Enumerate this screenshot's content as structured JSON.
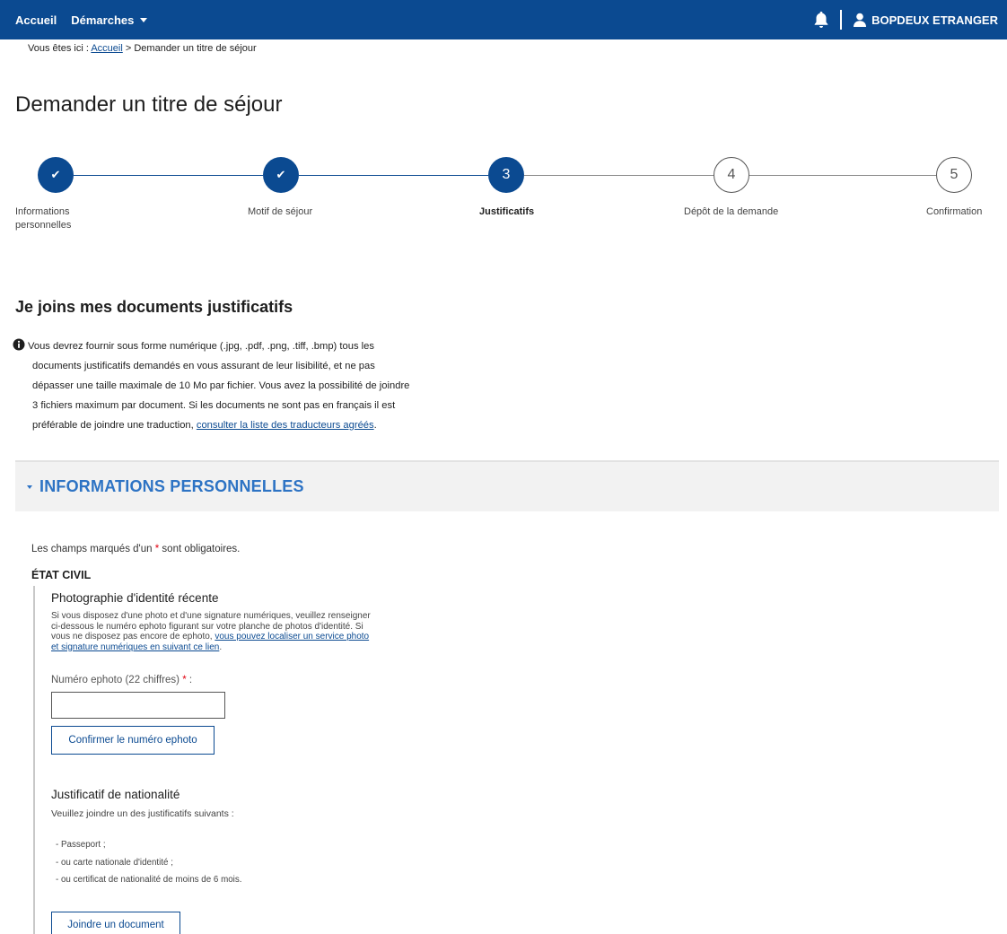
{
  "topbar": {
    "home_label": "Accueil",
    "demarches_label": "Démarches",
    "user_name": "BOPDEUX ETRANGER",
    "icons": {
      "bell": "bell-icon",
      "user": "user-icon",
      "caret": "caret-down-icon"
    },
    "colors": {
      "background": "#0b4a91",
      "text": "#ffffff"
    }
  },
  "breadcrumb": {
    "prefix": "Vous êtes ici :",
    "home_link": "Accueil",
    "separator": ">",
    "current": "Demander un titre de séjour"
  },
  "page": {
    "title": "Demander un titre de séjour"
  },
  "stepper": {
    "current_step": 3,
    "steps": [
      {
        "marker": "✔",
        "label_line1": "Informations",
        "label_line2": "personnelles",
        "state": "done"
      },
      {
        "marker": "✔",
        "label_line1": "Motif de séjour",
        "label_line2": "",
        "state": "done"
      },
      {
        "marker": "3",
        "label_line1": "Justificatifs",
        "label_line2": "",
        "state": "current"
      },
      {
        "marker": "4",
        "label_line1": "Dépôt de la demande",
        "label_line2": "",
        "state": "todo"
      },
      {
        "marker": "5",
        "label_line1": "Confirmation",
        "label_line2": "",
        "state": "todo"
      }
    ],
    "colors": {
      "active": "#0b4a91",
      "inactive_line": "#888888"
    }
  },
  "main": {
    "heading": "Je joins mes documents justificatifs",
    "info": {
      "icon": "info-icon",
      "line1": "Vous devrez fournir sous forme numérique (.jpg, .pdf, .png, .tiff, .bmp) tous les",
      "line2": "documents justificatifs demandés en vous assurant de leur lisibilité, et ne pas",
      "line3": "dépasser une taille maximale de 10 Mo par fichier. Vous avez la possibilité de joindre",
      "line4": "3 fichiers maximum par document. Si les documents ne sont pas en français il est",
      "line5_text": "préférable de joindre une traduction,",
      "line5_link": "consulter la liste des traducteurs agréés",
      "line5_end": "."
    },
    "accordion": {
      "title": "INFORMATIONS PERSONNELLES",
      "icon": "caret-down-icon",
      "expanded": true,
      "colors": {
        "title": "#2d73c4",
        "background": "#f2f2f2"
      }
    },
    "required_note": {
      "before": "Les champs marqués d'un",
      "star": "*",
      "after": "sont obligatoires."
    },
    "etat_civil": "ÉTAT CIVIL",
    "photo": {
      "title": "Photographie d'identité récente",
      "desc_line1": "Si vous disposez d'une photo et d'une signature numériques, veuillez renseigner",
      "desc_line2": "ci-dessous le numéro ephoto figurant sur votre planche de photos d'identité. Si",
      "desc_line3_text": "vous ne disposez pas encore de ephoto,",
      "desc_line3_link": "vous pouvez localiser un service photo",
      "desc_line4_link": "et signature numériques en suivant ce lien",
      "desc_line4_end": ".",
      "field_label": "Numéro ephoto (22 chiffres)",
      "field_star": "*",
      "field_colon": ":",
      "field_value": "",
      "confirm_button": "Confirmer le numéro ephoto"
    },
    "nationalite": {
      "title": "Justificatif de nationalité",
      "desc": "Veuillez joindre un des justificatifs suivants :",
      "items": [
        "- Passeport ;",
        "- ou carte nationale d'identité ;",
        "- ou certificat de nationalité de moins de 6 mois."
      ],
      "join_button": "Joindre un document"
    }
  }
}
